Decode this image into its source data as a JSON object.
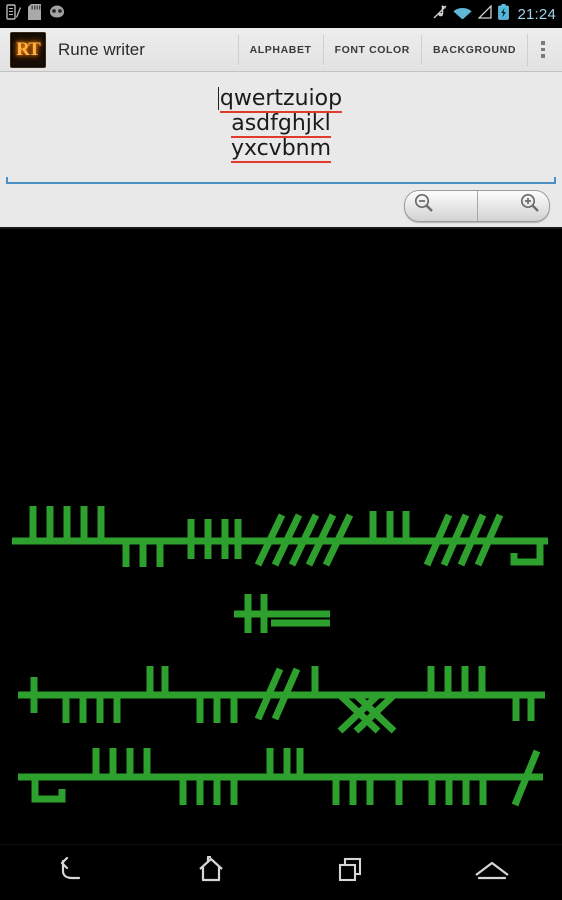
{
  "statusbar": {
    "time": "21:24",
    "left_icons": [
      "notepad-icon",
      "sd-card-icon",
      "cyanogenmod-icon"
    ],
    "right_icons": [
      "ringer-muted-icon",
      "wifi-icon",
      "cell-signal-icon",
      "battery-charging-icon"
    ],
    "background": "#000000",
    "clock_color": "#9fd3e8"
  },
  "actionbar": {
    "logo_text": "RT",
    "title": "Rune writer",
    "items": [
      {
        "label": "ALPHABET",
        "name": "alphabet"
      },
      {
        "label": "FONT COLOR",
        "name": "font-color"
      },
      {
        "label": "BACKGROUND",
        "name": "background"
      }
    ],
    "overflow_label": "More options",
    "background": "#e8e8e8"
  },
  "editor": {
    "line1": "qwertzuiop",
    "line2": "asdfghjkl",
    "line3": "yxcvbnm",
    "spellcheck_underline_color": "#e03b2c",
    "focus_underline_color": "#4a90c4",
    "cursor_visible": true
  },
  "zoom_controls": {
    "zoom_out_label": "Zoom out",
    "zoom_in_label": "Zoom in",
    "zoom_out_icon": "magnifier-minus-icon",
    "zoom_in_icon": "magnifier-plus-icon"
  },
  "canvas": {
    "background": "#000000",
    "stroke_color": "#2ea02e",
    "description": "Ogham-style rune rendering of the typed text"
  },
  "navbar": {
    "buttons": [
      {
        "label": "Back",
        "icon": "back-arrow-icon"
      },
      {
        "label": "Home",
        "icon": "home-icon"
      },
      {
        "label": "Recents",
        "icon": "recents-icon"
      },
      {
        "label": "Menu",
        "icon": "chevron-up-icon"
      }
    ],
    "background": "#000000"
  }
}
